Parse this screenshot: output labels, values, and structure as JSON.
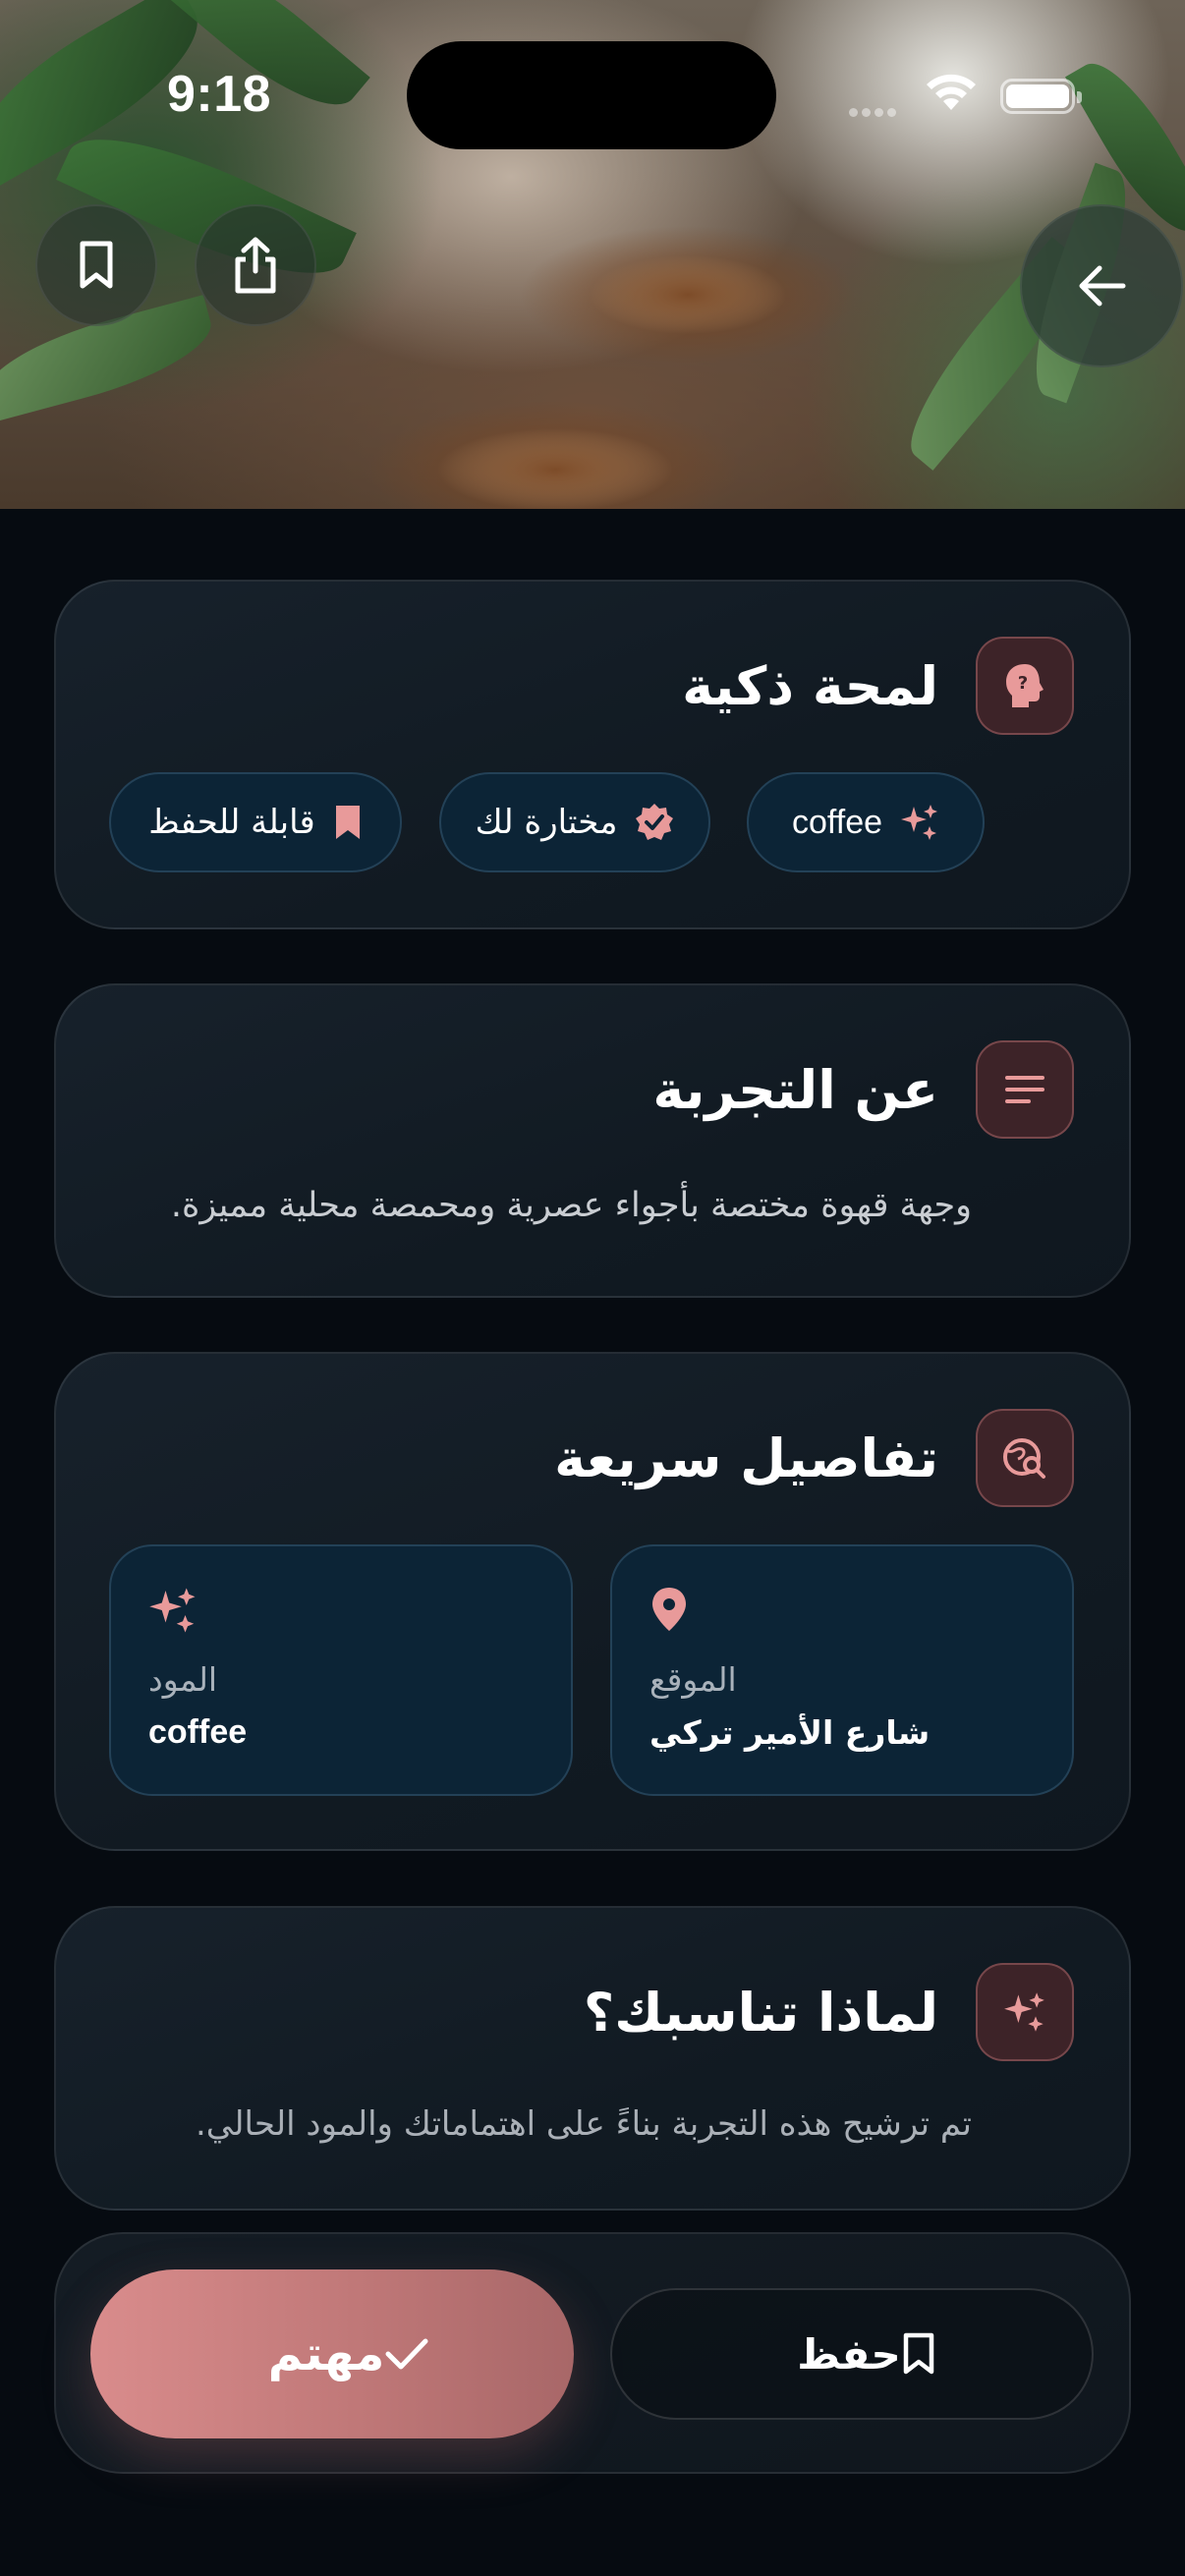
{
  "status_bar": {
    "time": "9:18"
  },
  "insight_card": {
    "title": "لمحة ذكية",
    "chips": [
      {
        "label": "coffee",
        "icon": "sparkles-icon"
      },
      {
        "label": "مختارة لك",
        "icon": "verified-badge-icon"
      },
      {
        "label": "قابلة للحفظ",
        "icon": "bookmark-icon"
      }
    ]
  },
  "about_card": {
    "title": "عن التجربة",
    "text": "وجهة قهوة مختصة بأجواء عصرية ومحمصة محلية مميزة."
  },
  "details_card": {
    "title": "تفاصيل سريعة",
    "location_label": "الموقع",
    "location_value": "شارع الأمير تركي",
    "mood_label": "المود",
    "mood_value": "coffee"
  },
  "why_card": {
    "title": "لماذا تناسبك؟",
    "text": "تم ترشيح هذه التجربة بناءً على اهتماماتك والمود الحالي."
  },
  "actions": {
    "interested_label": "مهتم",
    "save_label": "حفظ"
  },
  "colors": {
    "accent": "#d98c8c",
    "background": "#060b11",
    "chip_bg": "#0c2436"
  }
}
